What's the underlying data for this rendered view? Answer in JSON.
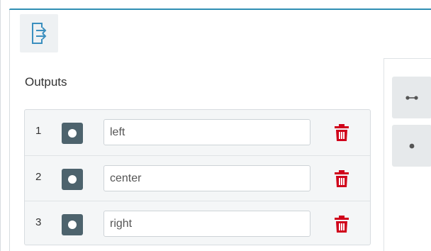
{
  "header": {
    "icon": "output-icon"
  },
  "outputs": {
    "title": "Outputs",
    "rows": [
      {
        "index": "1",
        "value": "left",
        "color": "#4d636d"
      },
      {
        "index": "2",
        "value": "center",
        "color": "#4d636d"
      },
      {
        "index": "3",
        "value": "right",
        "color": "#4d636d"
      }
    ]
  },
  "side_toolbar": {
    "buttons": [
      {
        "icon": "connector-icon"
      },
      {
        "icon": "dot-icon"
      }
    ]
  },
  "colors": {
    "accent": "#2f8fb3",
    "delete": "#d0021b",
    "swatch": "#4d636d"
  }
}
